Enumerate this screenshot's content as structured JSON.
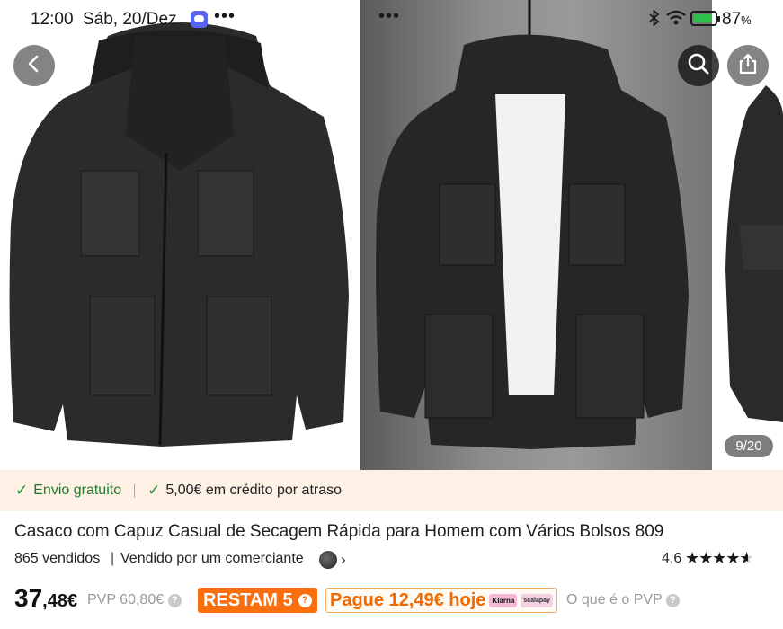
{
  "status_bar": {
    "time": "12:00",
    "date": "Sáb, 20/Dez",
    "dots": "•••",
    "battery": "87",
    "battery_unit": "%"
  },
  "gallery": {
    "counter": "9/20",
    "icons": [
      "back-icon",
      "search-icon",
      "share-icon"
    ]
  },
  "shipping": {
    "free": "Envio gratuito",
    "credit": "5,00€ em crédito por atraso"
  },
  "product": {
    "title": "Casaco com Capuz Casual de Secagem Rápida para Homem com Vários Bolsos 809",
    "sold": "865 vendidos",
    "separator": "|",
    "seller": "Vendido por um comerciante",
    "rating": "4,6",
    "stars": 4.6
  },
  "price": {
    "integer": "37",
    "decimal": ",48€",
    "pvp": "PVP 60,80€",
    "stock_badge": "RESTAM 5",
    "installment": "Pague 12,49€ hoje",
    "klarna": "Klarna",
    "scalapay": "scalapay",
    "what_is_pvp": "O que é o PVP"
  },
  "colors": {
    "accent_orange": "#f96e0e",
    "shipping_green": "#1f8b2c",
    "banner_bg": "#fdf1e6"
  }
}
